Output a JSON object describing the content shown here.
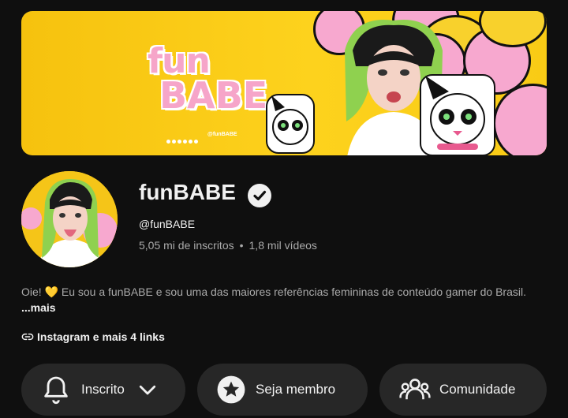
{
  "banner": {
    "logo_line1": "fun",
    "logo_line2": "BABE",
    "social_handle": "@funBABE"
  },
  "channel": {
    "title": "funBABE",
    "handle": "@funBABE",
    "subscribers": "5,05 mi de inscritos",
    "separator": "•",
    "videos": "1,8 mil vídeos",
    "verified_icon": "verified-check-icon"
  },
  "description": {
    "text": "Oie! 💛 Eu sou a funBABE e sou uma das maiores referências femininas de conteúdo gamer do Brasil.",
    "more_label": "...mais"
  },
  "links": {
    "label": "Instagram e mais 4 links",
    "icon": "link-icon"
  },
  "actions": {
    "subscribed_label": "Inscrito",
    "member_label": "Seja membro",
    "community_label": "Comunidade"
  },
  "colors": {
    "background": "#0f0f0f",
    "button_bg": "#272727",
    "banner_yellow": "#f9cb15",
    "banner_pink": "#f7a8cf",
    "secondary_text": "#aaaaaa"
  }
}
